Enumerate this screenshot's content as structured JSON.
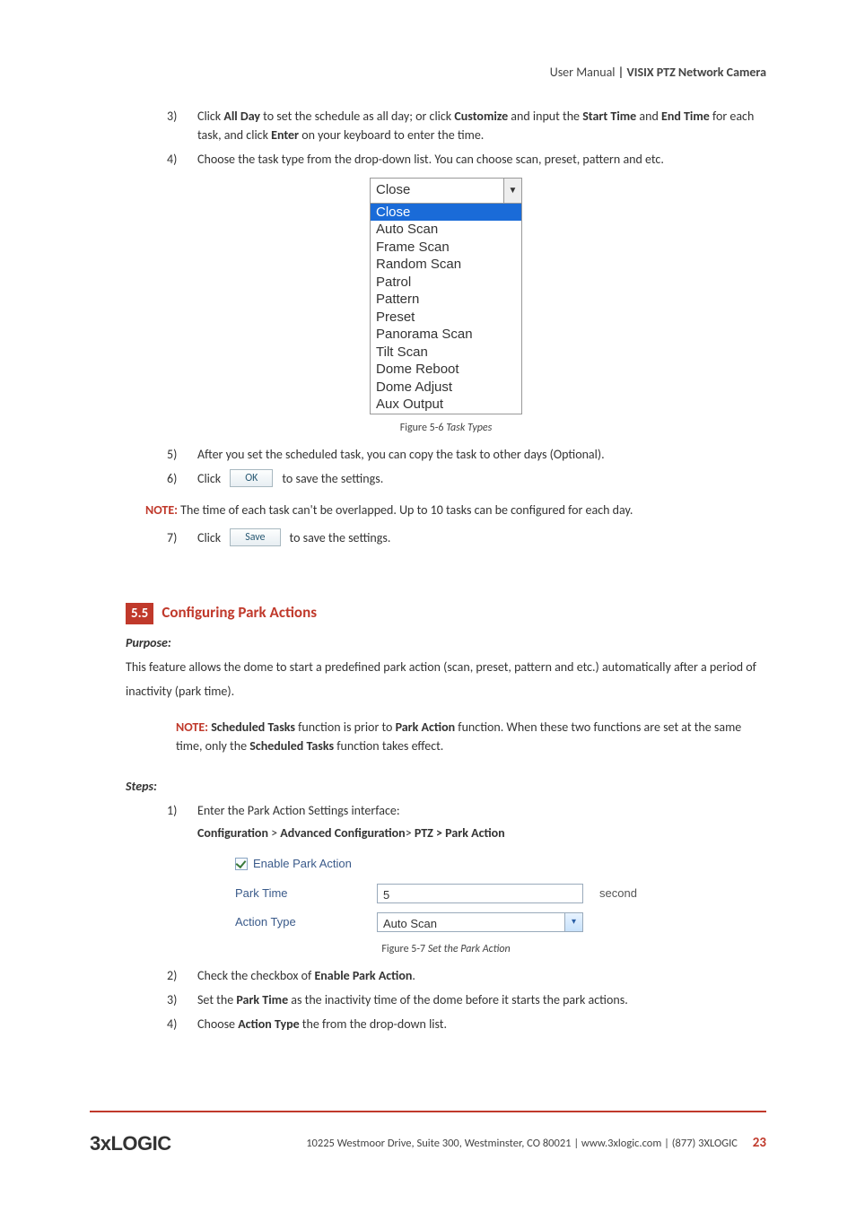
{
  "header": {
    "left": "User Manual ",
    "right": "| VISIX PTZ Network Camera"
  },
  "steps_a": {
    "s3": {
      "num": "3)",
      "pre": "Click ",
      "b1": "All Day",
      "mid1": " to set the schedule as all day; or click ",
      "b2": "Customize",
      "mid2": " and input the ",
      "b3": "Start Time",
      "mid3": " and ",
      "b4": "End Time",
      "mid4": " for each task, and click ",
      "b5": "Enter",
      "tail": " on your keyboard to enter the time."
    },
    "s4": {
      "num": "4)",
      "text": "Choose the task type from the drop-down list. You can choose scan, preset, pattern and etc."
    },
    "s5": {
      "num": "5)",
      "text": "After you set the scheduled task, you can copy the task to other days (Optional)."
    },
    "s6": {
      "num": "6)",
      "pre": "Click ",
      "btn": "OK",
      "post": " to save the settings."
    },
    "s7": {
      "num": "7)",
      "pre": "Click ",
      "btn": "Save",
      "post": " to save the settings."
    }
  },
  "dropdown_fig": {
    "selected": "Close",
    "highlighted": "Close",
    "options": [
      "Auto Scan",
      "Frame Scan",
      "Random Scan",
      "Patrol",
      "Pattern",
      "Preset",
      "Panorama Scan",
      "Tilt Scan",
      "Dome Reboot",
      "Dome Adjust",
      "Aux Output"
    ]
  },
  "caption1": {
    "pre": "Figure 5-6 ",
    "it": "Task Types"
  },
  "note1": {
    "label": "NOTE:",
    "text": " The time of each task can't be overlapped. Up to 10 tasks can be configured for each day."
  },
  "section": {
    "num": "5.5",
    "title": "Configuring Park Actions"
  },
  "purpose_label": "Purpose:",
  "purpose_text": "This feature allows the dome to start a predefined park action (scan, preset, pattern and etc.) automatically after a period of inactivity (park time).",
  "note2": {
    "label": "NOTE:",
    "p1a": " ",
    "b1": "Scheduled Tasks",
    "p1b": " function is prior to ",
    "b2": "Park Action",
    "p1c": " function. When these two functions are set at the same time, only the ",
    "b3": "Scheduled Tasks",
    "p1d": " function takes effect."
  },
  "steps_label": "Steps:",
  "steps_b": {
    "s1": {
      "num": "1)",
      "text": "Enter the Park Action Settings interface:",
      "path_a": "Configuration",
      "gt1": " > ",
      "path_b": "Advanced Configuration",
      "gt2": "> ",
      "path_c": "PTZ > Park Action"
    },
    "s2": {
      "num": "2)",
      "pre": "Check the checkbox of ",
      "b": "Enable Park Action",
      "post": "."
    },
    "s3": {
      "num": "3)",
      "pre": "Set the ",
      "b": "Park Time",
      "post": " as the inactivity time of the dome before it starts the park actions."
    },
    "s4": {
      "num": "4)",
      "pre": "Choose ",
      "b": "Action Type",
      "post": " the from the drop-down list."
    }
  },
  "park_fig": {
    "chk_label": "Enable Park Action",
    "row1_label": "Park Time",
    "row1_value": "5",
    "row1_unit": "second",
    "row2_label": "Action Type",
    "row2_value": "Auto Scan"
  },
  "caption2": {
    "pre": "Figure 5-7  ",
    "it": "Set the Park Action"
  },
  "footer": {
    "logo": "3xLOGIC",
    "addr": "10225 Westmoor Drive, Suite 300, Westminster, CO 80021 | www.3xlogic.com | (877) 3XLOGIC",
    "page": "23"
  }
}
